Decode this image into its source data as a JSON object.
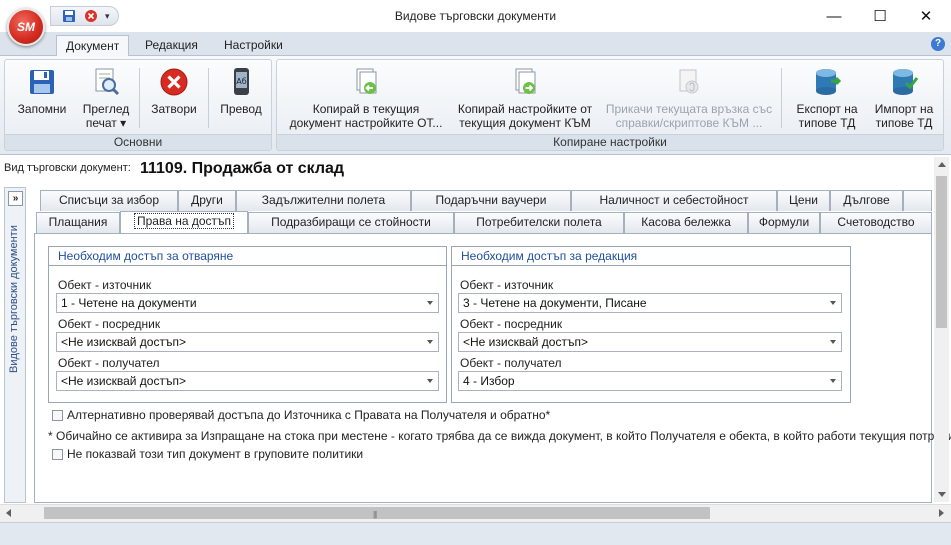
{
  "window": {
    "title": "Видове търговски документи",
    "logo_text": "SM",
    "minimize_glyph": "—",
    "maximize_glyph": "☐",
    "close_glyph": "✕"
  },
  "ribbon_tabs": [
    "Документ",
    "Редакция",
    "Настройки"
  ],
  "active_ribbon_tab": "Документ",
  "ribbon": {
    "groups": [
      {
        "caption": "Основни",
        "buttons": [
          {
            "label": "Запомни",
            "icon": "save-icon"
          },
          {
            "label": "Преглед",
            "label2": "печат ▾",
            "icon": "print-preview-icon"
          },
          {
            "label": "Затвори",
            "icon": "close-circle-icon"
          },
          {
            "label": "Превод",
            "icon": "translate-icon"
          }
        ]
      },
      {
        "caption": "Копиране настройки",
        "buttons": [
          {
            "label": "Копирай в текущия",
            "label2": "документ настройките ОТ...",
            "icon": "copy-from-icon"
          },
          {
            "label": "Копирай настройките от",
            "label2": "текущия документ КЪМ",
            "icon": "copy-to-icon"
          },
          {
            "label": "Прикачи текущата връзка със",
            "label2": "справки/скриптове КЪМ ...",
            "icon": "attach-link-icon",
            "disabled": true
          },
          {
            "label": "Експорт на",
            "label2": "типове ТД",
            "icon": "export-db-icon"
          },
          {
            "label": "Импорт на",
            "label2": "типове ТД",
            "icon": "import-db-icon"
          }
        ]
      }
    ]
  },
  "doc_type": {
    "label": "Вид търговски документ:",
    "value": "11109. Продажба от склад"
  },
  "side_panel": {
    "toggle": "»",
    "label": "Видове търговски документи"
  },
  "tabs_row1": [
    "Списъци за избор",
    "Други",
    "Задължителни полета",
    "Подаръчни ваучери",
    "Наличност и себестойност",
    "Цени",
    "Дългове"
  ],
  "tabs_row2": [
    "Плащания",
    "Права на достъп",
    "Подразбиращи се стойности",
    "Потребителски полета",
    "Касова бележка",
    "Формули",
    "Счетоводство"
  ],
  "active_tab": "Права на достъп",
  "open_access": {
    "header": "Необходим достъп за отваряне",
    "source_label": "Обект - източник",
    "source_value": "1 - Четене на документи",
    "intermediary_label": "Обект - посредник",
    "intermediary_value": "<Не изисквай достъп>",
    "receiver_label": "Обект - получател",
    "receiver_value": "<Не изисквай достъп>"
  },
  "edit_access": {
    "header": "Необходим достъп за редакция",
    "source_label": "Обект - източник",
    "source_value": "3 - Четене на документи, Писане",
    "intermediary_label": "Обект - посредник",
    "intermediary_value": "<Не изисквай достъп>",
    "receiver_label": "Обект - получател",
    "receiver_value": "4 - Избор"
  },
  "options": {
    "alt_check_label": "Алтернативно проверявай достъпа до Източника с Правата на Получателя и обратно*",
    "note": "* Обичайно се активира за Изпращане на стока при местене - когато трябва да се вижда документ, в който Получателя е обекта, в който работи текущия потребител",
    "hide_in_policies_label": "Не показвай този тип документ в груповите политики"
  }
}
